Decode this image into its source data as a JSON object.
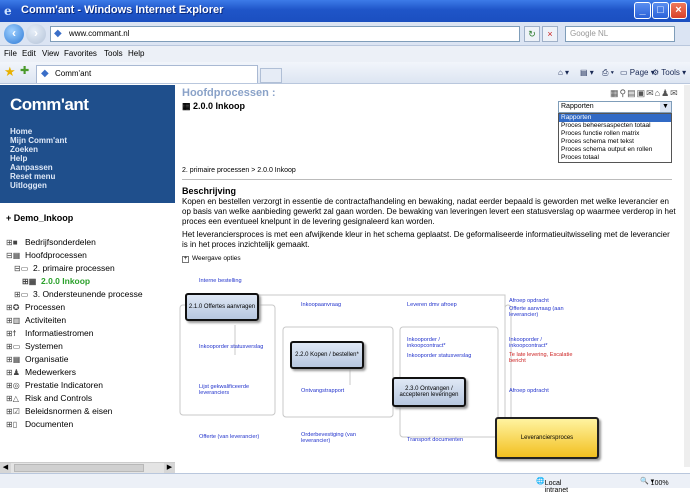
{
  "window": {
    "title": "Comm'ant - Windows Internet Explorer"
  },
  "addressbar": {
    "url": "www.commant.nl",
    "search_placeholder": "Google NL"
  },
  "menu": [
    "File",
    "Edit",
    "View",
    "Favorites",
    "Tools",
    "Help"
  ],
  "tab": {
    "label": "Comm'ant"
  },
  "commandbar": {
    "page": "Page",
    "tools": "Tools"
  },
  "sidebar": {
    "logo": "Comm'ant",
    "nav": [
      "Home",
      "Mijn Comm'ant",
      "Zoeken",
      "Help",
      "Aanpassen",
      "Reset menu",
      "Uitloggen"
    ],
    "tree_title": "+ Demo_Inkoop",
    "tree": [
      {
        "label": "Bedrijfsonderdelen",
        "indent": 0
      },
      {
        "label": "Hoofdprocessen",
        "indent": 0
      },
      {
        "label": "2. primaire processen",
        "indent": 1
      },
      {
        "label": "2.0.0 Inkoop",
        "indent": 2,
        "active": true
      },
      {
        "label": "3. Ondersteunende processe",
        "indent": 1
      },
      {
        "label": "Processen",
        "indent": 0
      },
      {
        "label": "Activiteiten",
        "indent": 0
      },
      {
        "label": "Informatiestromen",
        "indent": 0
      },
      {
        "label": "Systemen",
        "indent": 0
      },
      {
        "label": "Organisatie",
        "indent": 0
      },
      {
        "label": "Medewerkers",
        "indent": 0
      },
      {
        "label": "Prestatie Indicatoren",
        "indent": 0
      },
      {
        "label": "Risk and Controls",
        "indent": 0
      },
      {
        "label": "Beleidsnormen & eisen",
        "indent": 0
      },
      {
        "label": "Documenten",
        "indent": 0
      }
    ]
  },
  "main": {
    "heading": "Hoofdprocessen :",
    "subheading": "2.0.0 Inkoop",
    "select_value": "Rapporten",
    "dropdown": [
      "Rapporten",
      "Proces beheersaspecten totaal",
      "Proces functie rollen matrix",
      "Proces schema met tekst",
      "Proces schema output en rollen",
      "Proces totaal"
    ],
    "breadcrumb": "2. primaire processen > 2.0.0 Inkoop",
    "section_title": "Beschrijving",
    "para1": "Kopen en bestellen verzorgt in essentie de contractafhandeling en bewaking, nadat eerder bepaald is geworden met welke leverancier en op basis van welke aanbieding gewerkt zal gaan worden. De bewaking van leveringen levert een statusverslag op waarmee verderop in het proces een eventueel knelpunt in de levering gesignaleerd kan worden.",
    "para2": "Het leveranciersproces is met een afwijkende kleur in het schema geplaatst. De geformaliseerde informatieuitwisseling met de leverancier is in het proces inzichtelijk gemaakt.",
    "weergave": "Weergave opties"
  },
  "diagram": {
    "boxes": [
      "2.1.0 Offertes aanvragen",
      "2.2.0 Kopen / bestellen*",
      "2.3.0 Ontvangen / accepteren leveringen",
      "Leveranciersproces"
    ],
    "labels": {
      "interne": "Interne bestelling",
      "inkoopaanvraag": "Inkoopaanvraag",
      "leveren": "Leveren dmv afroep",
      "afroep1": "Afroep opdracht",
      "offerte_aanvraag": "Offerte aanvraag (aan leverancier)",
      "inkooporder_status": "Inkooporder statusverslag",
      "inkooporder_contract": "Inkooporder / inkoopcontract*",
      "inkooporder_status2": "Inkooporder statusverslag",
      "inkooporder_contract2": "Inkooporder / inkoopcontract*",
      "te_late": "Te late levering, Escalatie bericht",
      "lijst": "Lijst gekwalificeerde leveranciers",
      "ontvangst": "Ontvangstrapport",
      "afroep2": "Afroep opdracht",
      "offerte_lev": "Offerte (van leverancier)",
      "orderbev": "Orderbevestiging (van leverancier)",
      "transport": "Transport documenten"
    }
  },
  "status": {
    "zone": "Local intranet",
    "zoom": "100%"
  }
}
